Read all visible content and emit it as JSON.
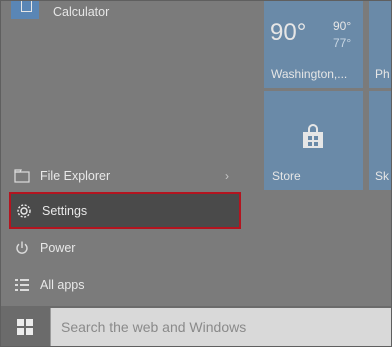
{
  "apps": {
    "calculator": "Calculator"
  },
  "menu": {
    "file_explorer": "File Explorer",
    "settings": "Settings",
    "power": "Power",
    "all_apps": "All apps"
  },
  "tiles": {
    "weather": {
      "temp": "90°",
      "high": "90°",
      "low": "77°",
      "city": "Washington,..."
    },
    "phone_partial": "Ph",
    "store": "Store",
    "sky_partial": "Sk"
  },
  "taskbar": {
    "search_placeholder": "Search the web and Windows"
  },
  "colors": {
    "highlight_border": "#b3141f",
    "tile_blue": "#6a8aa8",
    "menu_bg": "#7b7b7b"
  }
}
